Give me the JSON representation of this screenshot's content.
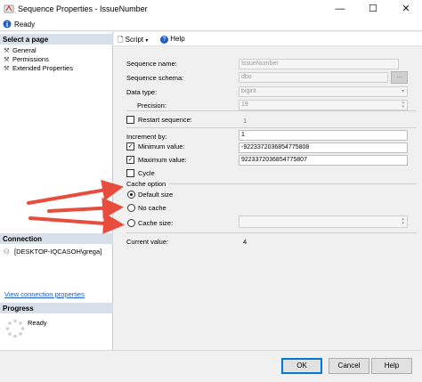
{
  "window": {
    "title": "Sequence Properties - IssueNumber",
    "minimize": "—",
    "maximize": "☐",
    "close": "✕"
  },
  "status": {
    "text": "Ready"
  },
  "left": {
    "select_page_header": "Select a page",
    "pages": [
      "General",
      "Permissions",
      "Extended Properties"
    ],
    "connection_header": "Connection",
    "connection_text": "[DESKTOP-IQCASOH\\grega]",
    "view_connection_link": "View connection properties",
    "progress_header": "Progress",
    "progress_text": "Ready"
  },
  "toolbar": {
    "script_label": "Script",
    "help_label": "Help"
  },
  "form": {
    "sequence_name_label": "Sequence name:",
    "sequence_name_value": "IssueNumber",
    "sequence_schema_label": "Sequence schema:",
    "sequence_schema_value": "dbo",
    "browse_label": "...",
    "data_type_label": "Data type:",
    "data_type_value": "bigint",
    "precision_label": "Precision:",
    "precision_value": "19",
    "restart_label": "Restart sequence:",
    "restart_value": "1",
    "increment_label": "Increment by:",
    "increment_value": "1",
    "min_label": "Minimum value:",
    "min_value": "-9223372036854775808",
    "max_label": "Maximum value:",
    "max_value": "9223372036854775807",
    "cycle_label": "Cycle",
    "cache_option_label": "Cache option",
    "default_size_label": "Default size",
    "no_cache_label": "No cache",
    "cache_size_label": "Cache size:",
    "cache_size_value": "",
    "current_value_label": "Current value:",
    "current_value": "4"
  },
  "buttons": {
    "ok": "OK",
    "cancel": "Cancel",
    "help": "Help"
  },
  "colors": {
    "arrow": "#e74c3c",
    "section_header": "#d7dfea",
    "link": "#1f5fbf",
    "ok_border": "#0078d7"
  }
}
